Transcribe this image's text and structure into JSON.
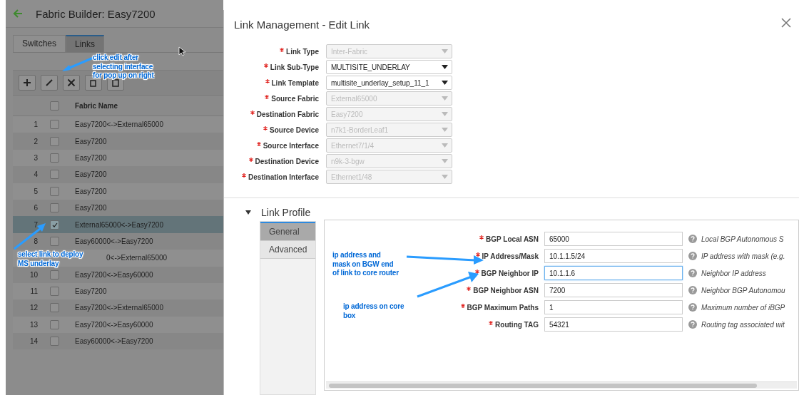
{
  "page": {
    "title": "Fabric Builder: Easy7200",
    "tabs": [
      {
        "label": "Switches",
        "selected": false
      },
      {
        "label": "Links",
        "selected": true
      }
    ],
    "toolbar": [
      {
        "kind": "add"
      },
      {
        "kind": "edit"
      },
      {
        "kind": "delete"
      },
      {
        "kind": "copy"
      },
      {
        "kind": "paste"
      }
    ],
    "table": {
      "columns": [
        "Fabric Name"
      ],
      "all_checked": false,
      "rows": [
        {
          "number": "1",
          "name": "Easy7200<->External65000",
          "checked": false,
          "selected": false
        },
        {
          "number": "2",
          "name": "Easy7200",
          "checked": false,
          "selected": false
        },
        {
          "number": "3",
          "name": "Easy7200",
          "checked": false,
          "selected": false
        },
        {
          "number": "4",
          "name": "Easy7200",
          "checked": false,
          "selected": false
        },
        {
          "number": "5",
          "name": "Easy7200",
          "checked": false,
          "selected": false
        },
        {
          "number": "6",
          "name": "Easy7200",
          "checked": false,
          "selected": false
        },
        {
          "number": "7",
          "name": "External65000<->Easy7200",
          "checked": true,
          "selected": true
        },
        {
          "number": "8",
          "name": "Easy60000<->Easy7200",
          "checked": false,
          "selected": false
        },
        {
          "name": "0<->External65000",
          "selected": false
        },
        {
          "number": "10",
          "name": "Easy7200<->Easy60000",
          "checked": false,
          "selected": false
        },
        {
          "number": "11",
          "name": "Easy7200",
          "checked": false,
          "selected": false
        },
        {
          "number": "12",
          "name": "Easy7200<->External65000",
          "checked": false,
          "selected": false
        },
        {
          "number": "13",
          "name": "Easy7200<->Easy60000",
          "checked": false,
          "selected": false
        },
        {
          "number": "14",
          "name": "Easy60000<->Easy7200",
          "checked": false,
          "selected": false
        }
      ]
    }
  },
  "dialog": {
    "title": "Link Management - Edit Link",
    "fields": [
      {
        "label": "Link Type",
        "value": "Inter-Fabric",
        "required": true,
        "disabled": true
      },
      {
        "label": "Link Sub-Type",
        "value": "MULTISITE_UNDERLAY",
        "required": true,
        "disabled": false
      },
      {
        "label": "Link Template",
        "value": "multisite_underlay_setup_11_1",
        "required": true,
        "disabled": false
      },
      {
        "label": "Source Fabric",
        "value": "External65000",
        "required": true,
        "disabled": true
      },
      {
        "label": "Destination Fabric",
        "value": "Easy7200",
        "required": true,
        "disabled": true
      },
      {
        "label": "Source Device",
        "value": "n7k1-BorderLeaf1",
        "required": true,
        "disabled": true
      },
      {
        "label": "Source Interface",
        "value": "Ethernet7/1/4",
        "required": true,
        "disabled": true
      },
      {
        "label": "Destination Device",
        "value": "n9k-3-bgw",
        "required": true,
        "disabled": true
      },
      {
        "label": "Destination Interface",
        "value": "Ethernet1/48",
        "required": true,
        "disabled": true
      }
    ],
    "profile": {
      "title": "Link Profile",
      "expanded": true,
      "tabs": [
        {
          "label": "General",
          "selected": true
        },
        {
          "label": "Advanced",
          "selected": false
        }
      ],
      "fields": [
        {
          "label": "BGP Local ASN",
          "value": "65000",
          "help": "Local BGP Autonomous S",
          "required": true,
          "focused": false
        },
        {
          "label": "IP Address/Mask",
          "value": "10.1.1.5/24",
          "help": "IP address with mask (e.g.",
          "required": true,
          "focused": false
        },
        {
          "label": "BGP Neighbor IP",
          "value": "10.1.1.6",
          "help": "Neighbor IP address",
          "required": true,
          "focused": true
        },
        {
          "label": "BGP Neighbor ASN",
          "value": "7200",
          "help": "Neighbor BGP Autonomou",
          "required": true,
          "focused": false
        },
        {
          "label": "BGP Maximum Paths",
          "value": "1",
          "help": "Maximum number of iBGP",
          "required": true,
          "focused": false
        },
        {
          "label": "Routing TAG",
          "value": "54321",
          "help": "Routing tag associated wit",
          "required": true,
          "focused": false
        }
      ]
    }
  },
  "annotations": [
    {
      "lines": [
        "click edit after",
        "selecting interface",
        "for pop up on right"
      ]
    },
    {
      "lines": [
        "select link to deploy",
        "MS underlay"
      ]
    },
    {
      "lines": [
        "ip address and",
        "mask on BGW end",
        "of link to core router"
      ]
    },
    {
      "lines": [
        "ip address on core",
        "box"
      ]
    }
  ]
}
